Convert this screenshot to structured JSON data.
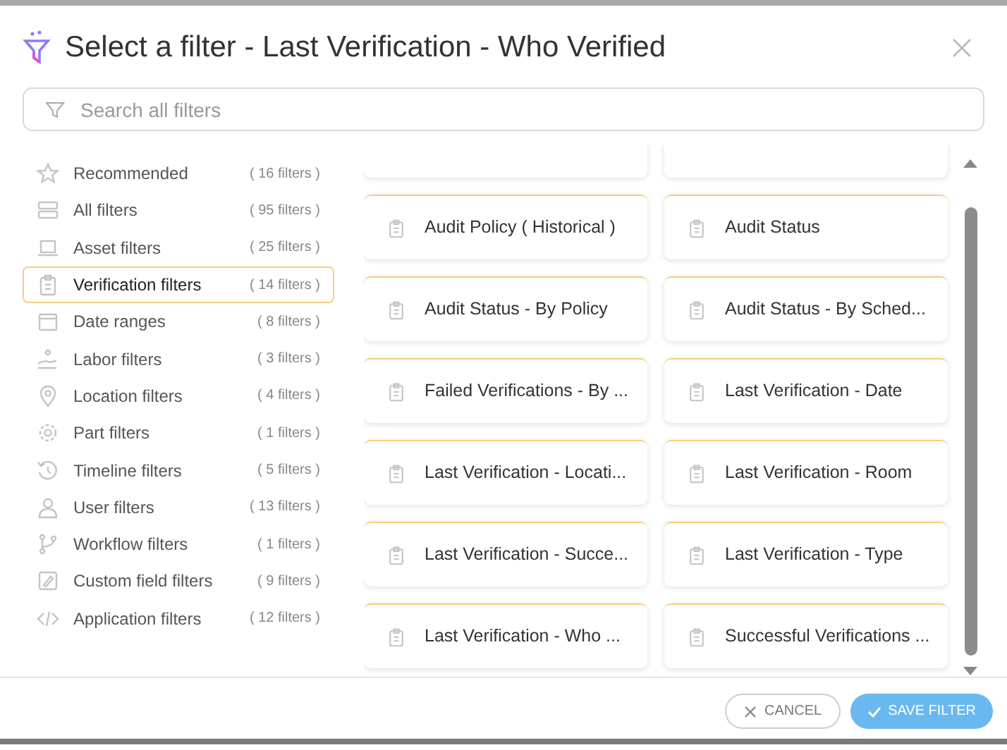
{
  "dialog": {
    "title": "Select a filter - Last Verification - Who Verified"
  },
  "search": {
    "placeholder": "Search all filters"
  },
  "sidebar": {
    "items": [
      {
        "label": "Recommended",
        "count": "( 16 filters )",
        "selected": false
      },
      {
        "label": "All filters",
        "count": "( 95 filters )",
        "selected": false
      },
      {
        "label": "Asset filters",
        "count": "( 25 filters )",
        "selected": false
      },
      {
        "label": "Verification filters",
        "count": "( 14 filters )",
        "selected": true
      },
      {
        "label": "Date ranges",
        "count": "( 8 filters )",
        "selected": false
      },
      {
        "label": "Labor filters",
        "count": "( 3 filters )",
        "selected": false
      },
      {
        "label": "Location filters",
        "count": "( 4 filters )",
        "selected": false
      },
      {
        "label": "Part filters",
        "count": "( 1 filters )",
        "selected": false
      },
      {
        "label": "Timeline filters",
        "count": "( 5 filters )",
        "selected": false
      },
      {
        "label": "User filters",
        "count": "( 13 filters )",
        "selected": false
      },
      {
        "label": "Workflow filters",
        "count": "( 1 filters )",
        "selected": false
      },
      {
        "label": "Custom field filters",
        "count": "( 9 filters )",
        "selected": false
      },
      {
        "label": "Application filters",
        "count": "( 12 filters )",
        "selected": false
      }
    ]
  },
  "filters": [
    {
      "label": "Audit Policy ( Historical )"
    },
    {
      "label": "Audit Status"
    },
    {
      "label": "Audit Status - By Policy"
    },
    {
      "label": "Audit Status - By Sched..."
    },
    {
      "label": "Failed Verifications - By ..."
    },
    {
      "label": "Last Verification - Date"
    },
    {
      "label": "Last Verification - Locati..."
    },
    {
      "label": "Last Verification - Room"
    },
    {
      "label": "Last Verification - Succe..."
    },
    {
      "label": "Last Verification - Type"
    },
    {
      "label": "Last Verification - Who ..."
    },
    {
      "label": "Successful Verifications ..."
    }
  ],
  "buttons": [
    {
      "kind": "cancel",
      "label": "CANCEL"
    },
    {
      "kind": "save",
      "label": "SAVE FILTER"
    }
  ]
}
